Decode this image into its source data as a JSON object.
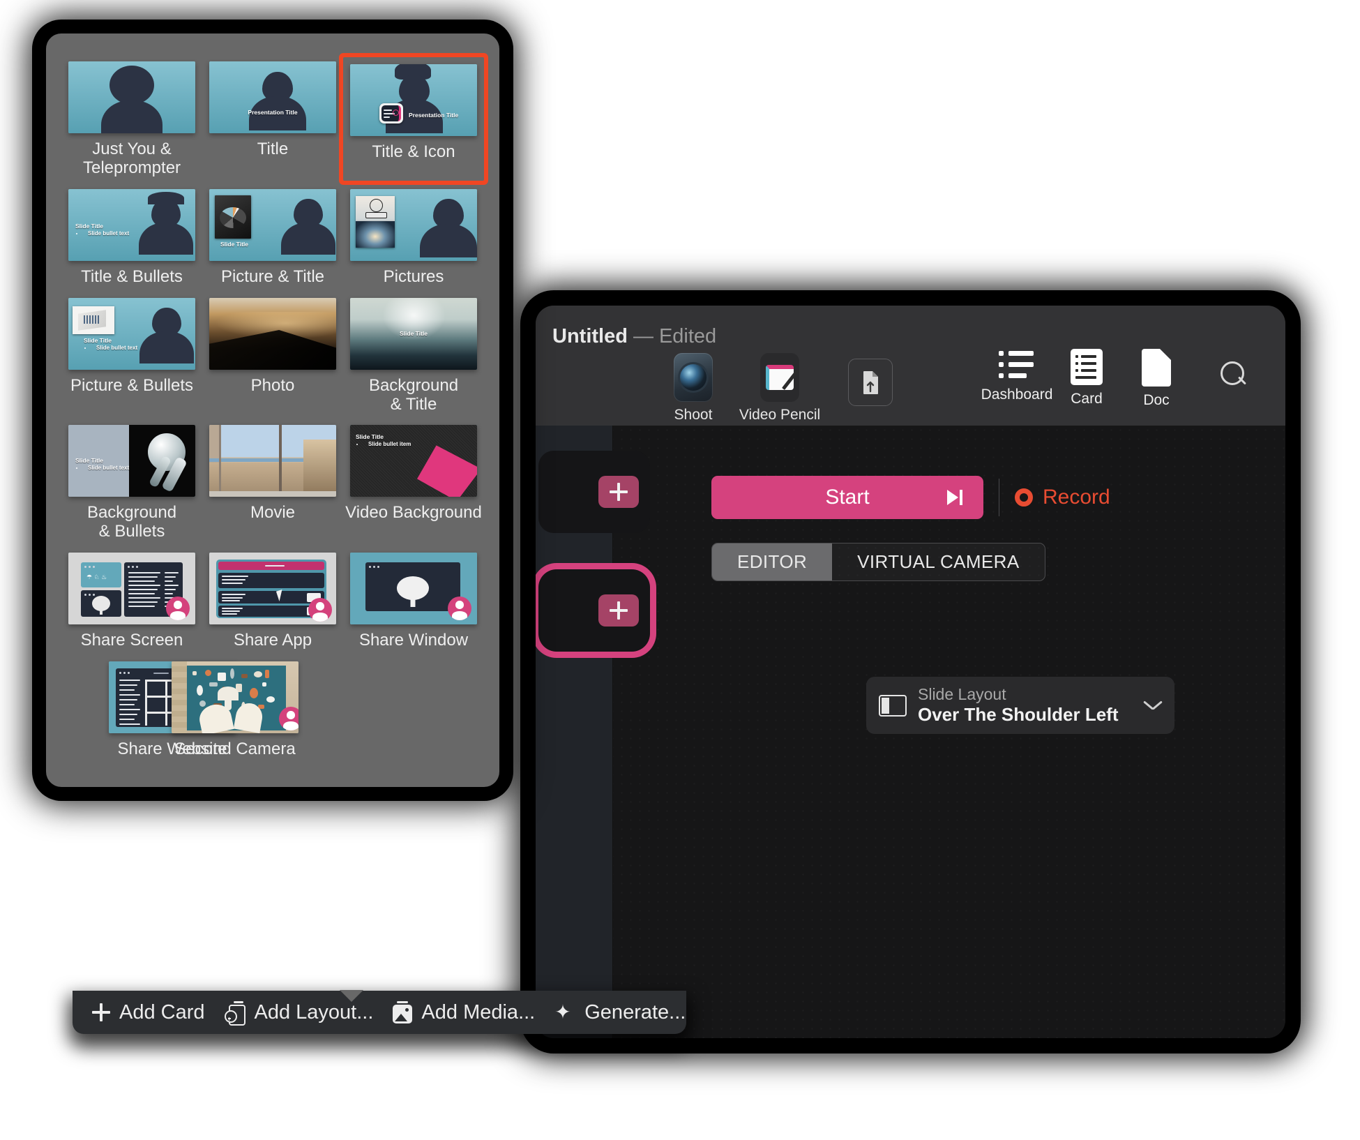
{
  "app_window": {
    "title": "Untitled",
    "title_separator": "—",
    "title_status": "Edited",
    "toolbar_left": [
      {
        "label": "Shoot",
        "icon": "camera-lens-icon"
      },
      {
        "label": "Video Pencil",
        "icon": "video-pencil-icon"
      }
    ],
    "share_button": {
      "label": "",
      "icon": "export-share-icon"
    },
    "toolbar_right": [
      {
        "label": "Dashboard",
        "icon": "list-icon"
      },
      {
        "label": "Card",
        "icon": "card-icon"
      },
      {
        "label": "Doc",
        "icon": "document-icon"
      }
    ],
    "search_icon": "search-icon",
    "editor": {
      "start_label": "Start",
      "start_next_icon": "skip-next-icon",
      "record_label": "Record",
      "record_icon": "record-dot-icon",
      "tabs": [
        {
          "label": "EDITOR",
          "selected": true
        },
        {
          "label": "VIRTUAL CAMERA",
          "selected": false
        }
      ],
      "slide_layout": {
        "caption": "Slide Layout",
        "value": "Over The Shoulder Left",
        "icon": "layout-split-left-icon",
        "chevron": "chevron-down-icon"
      },
      "add_card_buttons": [
        {
          "icon": "plus-icon",
          "selected": false
        },
        {
          "icon": "plus-icon",
          "selected": true
        }
      ]
    },
    "colors": {
      "accent_pink": "#d5427e",
      "record_red": "#e84c32",
      "titlebar": "#333335",
      "body": "#161617"
    }
  },
  "popover": {
    "selection_outline_color": "#f04623",
    "layouts": [
      {
        "name": "Just You &\nTeleprompter",
        "label": "Just You & Teleprompter",
        "kind": "person",
        "selected": false
      },
      {
        "name": "Title",
        "label": "Title",
        "kind": "person-title",
        "slide_title": "Presentation Title",
        "selected": false
      },
      {
        "name": "Title & Icon",
        "label": "Title & Icon",
        "kind": "person-title-icon",
        "slide_title": "Presentation Title",
        "selected": true
      },
      {
        "name": "Title & Bullets",
        "label": "Title & Bullets",
        "kind": "title-bullets",
        "slide_title": "Slide Title",
        "bullet": "Slide bullet text",
        "selected": false
      },
      {
        "name": "Picture & Title",
        "label": "Picture & Title",
        "kind": "picture-title",
        "slide_title": "Slide Title",
        "selected": false
      },
      {
        "name": "Pictures",
        "label": "Pictures",
        "kind": "pictures",
        "selected": false
      },
      {
        "name": "Picture & Bullets",
        "label": "Picture & Bullets",
        "kind": "picture-bullets",
        "slide_title": "Slide Title",
        "bullet": "Slide bullet text",
        "selected": false
      },
      {
        "name": "Photo",
        "label": "Photo",
        "kind": "photo",
        "selected": false
      },
      {
        "name": "Background\n& Title",
        "label": "Background & Title",
        "kind": "bg-title",
        "slide_title": "Slide Title",
        "selected": false
      },
      {
        "name": "Background\n& Bullets",
        "label": "Background & Bullets",
        "kind": "bg-bullets",
        "slide_title": "Slide Title",
        "bullet": "Slide bullet text",
        "selected": false
      },
      {
        "name": "Movie",
        "label": "Movie",
        "kind": "movie",
        "selected": false
      },
      {
        "name": "Video Background",
        "label": "Video Background",
        "kind": "video-bg",
        "slide_title": "Slide Title",
        "bullet": "Slide bullet item",
        "selected": false
      },
      {
        "name": "Share Screen",
        "label": "Share Screen",
        "kind": "share-screen",
        "selected": false
      },
      {
        "name": "Share App",
        "label": "Share App",
        "kind": "share-app",
        "selected": false
      },
      {
        "name": "Share Window",
        "label": "Share Window",
        "kind": "share-window",
        "selected": false
      },
      {
        "name": "Share Website",
        "label": "Share Website",
        "kind": "share-website",
        "selected": false
      },
      {
        "name": "Second Camera",
        "label": "Second Camera",
        "kind": "second-camera",
        "selected": false
      }
    ]
  },
  "bottom_toolbar": {
    "buttons": [
      {
        "label": "Add Card",
        "icon": "plus-icon"
      },
      {
        "label": "Add Layout...",
        "icon": "add-layout-icon"
      },
      {
        "label": "Add Media...",
        "icon": "add-media-icon"
      },
      {
        "label": "Generate...",
        "icon": "sparkle-wand-icon"
      }
    ]
  }
}
